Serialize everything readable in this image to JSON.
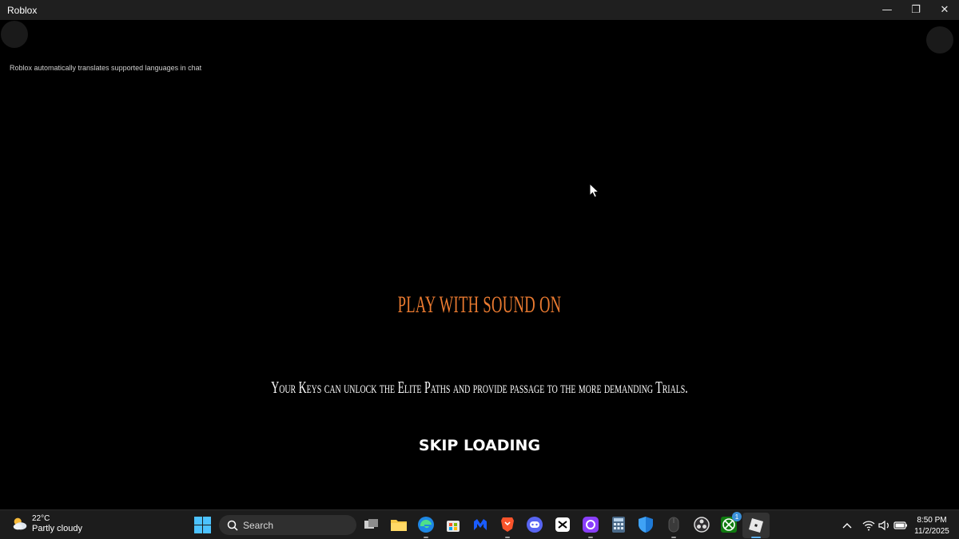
{
  "window": {
    "title": "Roblox",
    "minimize_glyph": "—",
    "restore_glyph": "❐",
    "close_glyph": "✕"
  },
  "game": {
    "translate_note": "Roblox automatically translates supported languages in chat",
    "sound_title": "PLAY WITH SOUND ON",
    "sound_title_color": "#ea7a30",
    "tip": "Your Keys can unlock the Elite Paths and provide passage to the more demanding Trials.",
    "skip_label": "SKIP LOADING"
  },
  "taskbar": {
    "weather": {
      "temp": "22°C",
      "condition": "Partly cloudy",
      "icon": "partly-cloudy-icon"
    },
    "search_label": "Search",
    "apps": [
      {
        "name": "task-view-icon"
      },
      {
        "name": "file-explorer-icon"
      },
      {
        "name": "edge-icon"
      },
      {
        "name": "microsoft-store-icon"
      },
      {
        "name": "malwarebytes-icon"
      },
      {
        "name": "brave-icon"
      },
      {
        "name": "discord-icon"
      },
      {
        "name": "capcut-icon"
      },
      {
        "name": "proton-vpn-icon"
      },
      {
        "name": "calculator-icon"
      },
      {
        "name": "defender-icon"
      },
      {
        "name": "mouse-app-icon"
      },
      {
        "name": "obs-icon"
      },
      {
        "name": "xbox-icon",
        "badge": "1"
      },
      {
        "name": "roblox-icon",
        "active": true
      }
    ],
    "clock": {
      "time": "8:50 PM",
      "date": "11/2/2025"
    }
  }
}
